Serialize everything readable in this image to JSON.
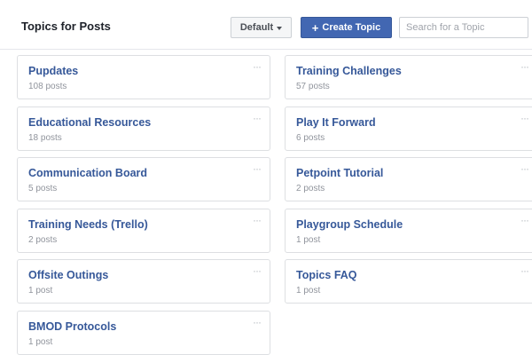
{
  "header": {
    "title": "Topics for Posts",
    "sort_label": "Default",
    "create_label": "Create Topic",
    "search_placeholder": "Search for a Topic"
  },
  "colors": {
    "accent": "#4267b2",
    "link": "#365899"
  },
  "topics_left": [
    {
      "name": "Pupdates",
      "count": "108 posts"
    },
    {
      "name": "Educational Resources",
      "count": "18 posts"
    },
    {
      "name": "Communication Board",
      "count": "5 posts"
    },
    {
      "name": "Training Needs (Trello)",
      "count": "2 posts"
    },
    {
      "name": "Offsite Outings",
      "count": "1 post"
    },
    {
      "name": "BMOD Protocols",
      "count": "1 post"
    }
  ],
  "topics_right": [
    {
      "name": "Training Challenges",
      "count": "57 posts"
    },
    {
      "name": "Play It Forward",
      "count": "6 posts"
    },
    {
      "name": "Petpoint Tutorial",
      "count": "2 posts"
    },
    {
      "name": "Playgroup Schedule",
      "count": "1 post"
    },
    {
      "name": "Topics FAQ",
      "count": "1 post"
    }
  ],
  "icons": {
    "more": "more-options-icon",
    "caret": "caret-down-icon",
    "plus": "plus-icon"
  }
}
